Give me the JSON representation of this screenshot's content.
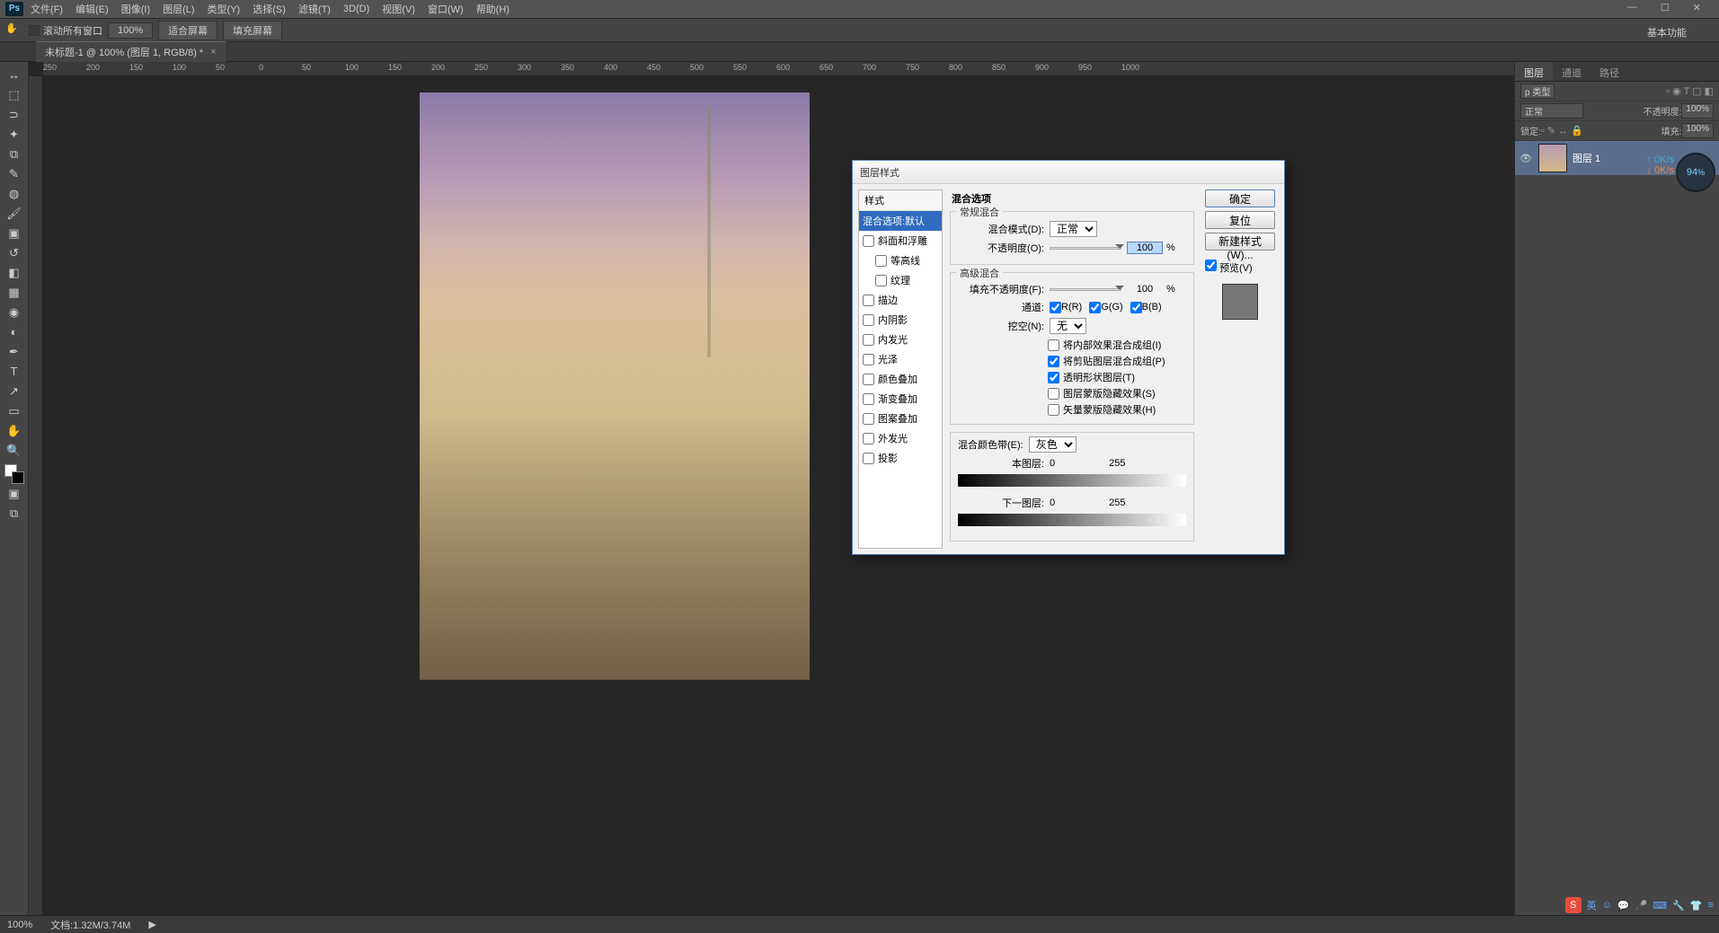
{
  "menu": {
    "file": "文件(F)",
    "edit": "编辑(E)",
    "image": "图像(I)",
    "layer": "图层(L)",
    "type": "类型(Y)",
    "select": "选择(S)",
    "filter": "滤镜(T)",
    "d3": "3D(D)",
    "view": "视图(V)",
    "window": "窗口(W)",
    "help": "帮助(H)"
  },
  "optbar": {
    "scroll": "滚动所有窗口",
    "zoom": "100%",
    "fit": "适合屏幕",
    "fill": "填充屏幕"
  },
  "basic": "基本功能",
  "doc_tab": "未标题-1 @ 100% (图层 1, RGB/8) *",
  "ruler_h": [
    "250",
    "200",
    "150",
    "100",
    "50",
    "0",
    "50",
    "100",
    "150",
    "200",
    "250",
    "300",
    "350",
    "400",
    "450",
    "500",
    "550",
    "600",
    "650",
    "700",
    "750",
    "800",
    "850",
    "900",
    "950",
    "1000"
  ],
  "panels": {
    "tabs": {
      "layers": "图层",
      "channels": "通道",
      "paths": "路径"
    },
    "kind": "p 类型",
    "mode": "正常",
    "opacity_l": "不透明度:",
    "opacity_v": "100%",
    "lock": "锁定:",
    "fill_l": "填充:",
    "fill_v": "100%",
    "layer_name": "图层 1"
  },
  "dlg": {
    "title": "图层样式",
    "styles_hd": "样式",
    "items": {
      "blend": "混合选项:默认",
      "bevel": "斜面和浮雕",
      "contour": "等高线",
      "texture": "纹理",
      "stroke": "描边",
      "inner_shadow": "内阴影",
      "inner_glow": "内发光",
      "satin": "光泽",
      "color_overlay": "颜色叠加",
      "gradient_overlay": "渐变叠加",
      "pattern_overlay": "图案叠加",
      "outer_glow": "外发光",
      "drop_shadow": "投影"
    },
    "opts_title": "混合选项",
    "general": "常规混合",
    "blend_mode_l": "混合模式(D):",
    "blend_mode_v": "正常",
    "opacity_l": "不透明度(O):",
    "opacity_v": "100",
    "pct": "%",
    "advanced": "高级混合",
    "fill_op_l": "填充不透明度(F):",
    "fill_op_v": "100",
    "channels_l": "通道:",
    "r": "R(R)",
    "g": "G(G)",
    "b": "B(B)",
    "knockout_l": "挖空(N):",
    "knockout_v": "无",
    "c1": "将内部效果混合成组(I)",
    "c2": "将剪贴图层混合成组(P)",
    "c3": "透明形状图层(T)",
    "c4": "图层蒙版隐藏效果(S)",
    "c5": "矢量蒙版隐藏效果(H)",
    "blendif": "混合颜色带(E):",
    "gray": "灰色",
    "this_l": "本图层:",
    "under_l": "下一图层:",
    "v0": "0",
    "v255": "255",
    "ok": "确定",
    "cancel": "复位",
    "newstyle": "新建样式(W)...",
    "preview": "预览(V)"
  },
  "overlay": {
    "pct": "94",
    "u": "%",
    "up": "0K/s",
    "dn": "0K/s"
  },
  "status": {
    "zoom": "100%",
    "doc": "文档:1.32M/3.74M"
  },
  "tray": {
    "lang": "英"
  }
}
